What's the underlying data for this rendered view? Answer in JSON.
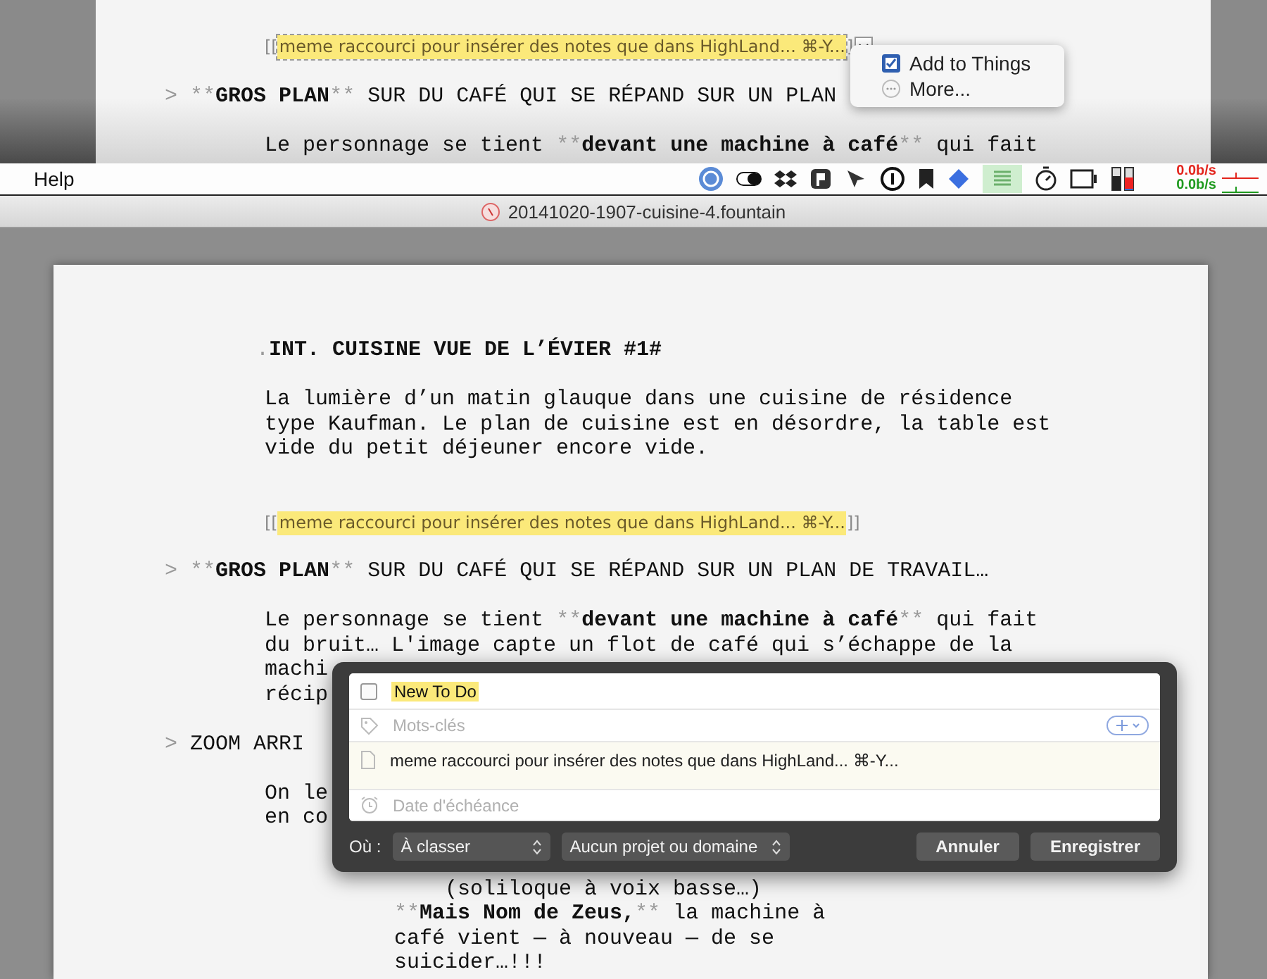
{
  "background_document": {
    "blocks": [
      {
        "kind": "note",
        "open": "[[",
        "text": "meme raccourci pour insérer des notes que dans HighLand... ⌘-Y...",
        "close": "]",
        "focused": true
      },
      {
        "kind": "section",
        "segments": [
          {
            "kind": "marker",
            "text": ">"
          },
          {
            "kind": "marker",
            "text": "**"
          },
          {
            "kind": "bold",
            "text": "GROS PLAN"
          },
          {
            "kind": "marker",
            "text": "**"
          },
          {
            "kind": "plain",
            "text": "SUR DU CAFÉ QUI SE RÉPAND SUR UN PLAN"
          }
        ]
      },
      {
        "kind": "action",
        "segments": [
          {
            "kind": "plain",
            "text": "Le personnage se tient"
          },
          {
            "kind": "marker",
            "text": "**"
          },
          {
            "kind": "bold",
            "text": "devant une machine à café"
          },
          {
            "kind": "marker",
            "text": "**"
          },
          {
            "kind": "plain",
            "text": "qui fait"
          }
        ]
      }
    ],
    "popup_menu": [
      {
        "kind": "things",
        "label": "Add to Things"
      },
      {
        "kind": "more",
        "label": "More..."
      }
    ]
  },
  "menu_bar": {
    "menus": [
      "Help"
    ],
    "network": [
      {
        "reading": "0.0b/s",
        "color": "#e3241c"
      },
      {
        "reading": "0.0b/s",
        "color": "#1f9a1f"
      }
    ]
  },
  "window": {
    "title": "20141020-1907-cuisine-4.fountain"
  },
  "document": {
    "blocks": [
      {
        "kind": "heading",
        "segments": [
          {
            "kind": "marker",
            "text": "."
          },
          {
            "kind": "bold",
            "text": "INT. CUISINE VUE DE L’ÉVIER #1#"
          }
        ]
      },
      {
        "kind": "action",
        "segments": [
          {
            "kind": "plain",
            "text": "La lumière d’un matin glauque dans une cuisine de résidence type Kaufman. Le plan de cuisine est en désordre, la table est vide du petit déjeuner encore vide."
          }
        ]
      },
      {
        "kind": "note",
        "open": "[[",
        "text": "meme raccourci pour insérer des notes que dans HighLand... ⌘-Y...",
        "close": "]]",
        "focused": false
      },
      {
        "kind": "section",
        "segments": [
          {
            "kind": "marker",
            "text": ">"
          },
          {
            "kind": "marker",
            "text": "**"
          },
          {
            "kind": "bold",
            "text": "GROS PLAN"
          },
          {
            "kind": "marker",
            "text": "**"
          },
          {
            "kind": "plain",
            "text": "SUR DU CAFÉ QUI SE RÉPAND SUR UN PLAN DE TRAVAIL…"
          }
        ]
      },
      {
        "kind": "action",
        "segments": [
          {
            "kind": "plain",
            "text": "Le personnage se tient"
          },
          {
            "kind": "marker",
            "text": "**"
          },
          {
            "kind": "bold",
            "text": "devant une machine à café"
          },
          {
            "kind": "marker",
            "text": "**"
          },
          {
            "kind": "plain",
            "text": "qui fait"
          }
        ]
      },
      {
        "kind": "action_cont",
        "segments": [
          {
            "kind": "plain",
            "text": "du bruit… L'image capte un flot de café qui s’échappe de la"
          }
        ]
      },
      {
        "kind": "action_cont",
        "segments": [
          {
            "kind": "plain",
            "text": "machi"
          }
        ]
      },
      {
        "kind": "action_cont",
        "segments": [
          {
            "kind": "plain",
            "text": "récip"
          }
        ]
      },
      {
        "kind": "section",
        "segments": [
          {
            "kind": "marker",
            "text": ">"
          },
          {
            "kind": "plain",
            "text": "ZOOM ARRI"
          }
        ]
      },
      {
        "kind": "action",
        "segments": [
          {
            "kind": "plain",
            "text": "On le"
          }
        ]
      },
      {
        "kind": "action_cont",
        "segments": [
          {
            "kind": "plain",
            "text": "en co"
          }
        ]
      },
      {
        "kind": "parenthetical",
        "segments": [
          {
            "kind": "plain",
            "text": "(soliloque à voix basse…)"
          }
        ]
      },
      {
        "kind": "dialogue",
        "segments": [
          {
            "kind": "marker",
            "text": "**"
          },
          {
            "kind": "bold",
            "text": "Mais Nom de Zeus,"
          },
          {
            "kind": "marker",
            "text": "**"
          },
          {
            "kind": "plain",
            "text": "la machine à café vient — à nouveau — de se suicider…!!!"
          }
        ]
      }
    ]
  },
  "things_dialog": {
    "title": {
      "text": "New To Do",
      "checked": false
    },
    "tags": {
      "placeholder": "Mots-clés"
    },
    "notes": "meme raccourci pour insérer des notes que dans HighLand... ⌘-Y...",
    "due_date": {
      "placeholder": "Date d'échéance"
    },
    "where_label": "Où :",
    "area_select": "À classer",
    "project_select": "Aucun projet ou domaine",
    "buttons": [
      "Annuler",
      "Enregistrer"
    ]
  }
}
